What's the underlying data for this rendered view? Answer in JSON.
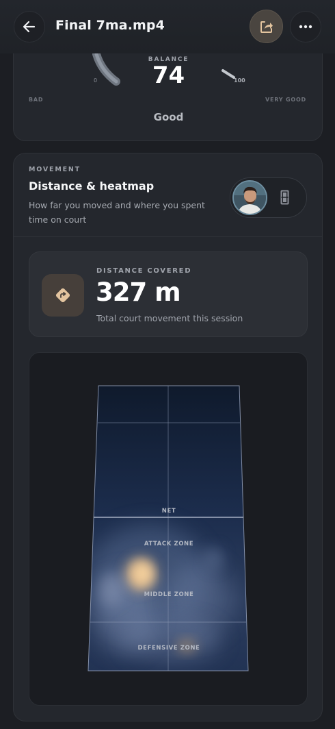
{
  "header": {
    "title": "Final 7ma.mp4",
    "back_icon": "arrow-left-icon",
    "share_icon": "share-icon",
    "more_icon": "more-horizontal-icon"
  },
  "balance_card": {
    "label": "BALANCE",
    "value": "74",
    "gauge_min": "0",
    "gauge_max": "100",
    "scale_low": "BAD",
    "scale_high": "VERY GOOD",
    "rating": "Good"
  },
  "movement_card": {
    "eyebrow": "MOVEMENT",
    "title": "Distance & heatmap",
    "description": "How far you moved and where you spent time on court",
    "toggle": {
      "player_icon": "player-avatar",
      "court_icon": "court-icon"
    },
    "distance": {
      "icon": "route-diamond-icon",
      "label": "DISTANCE COVERED",
      "value": "327 m",
      "subtitle": "Total court movement this session"
    },
    "heatmap": {
      "net_label": "NET",
      "zones": [
        "ATTACK ZONE",
        "MIDDLE ZONE",
        "DEFENSIVE ZONE"
      ]
    }
  },
  "colors": {
    "background": "#1c1e23",
    "card": "#24272d",
    "accent_tan": "#e3c49f",
    "share_button": "#4a4540"
  }
}
